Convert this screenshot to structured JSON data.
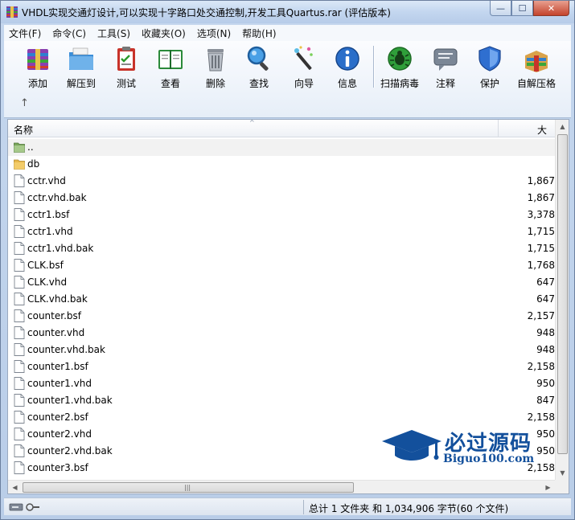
{
  "window": {
    "title": "VHDL实现交通灯设计,可以实现十字路口处交通控制,开发工具Quartus.rar (评估版本)",
    "controls": {
      "minimize": "—",
      "maximize": "☐",
      "close": "✕"
    }
  },
  "menu": [
    "文件(F)",
    "命令(C)",
    "工具(S)",
    "收藏夹(O)",
    "选项(N)",
    "帮助(H)"
  ],
  "toolbar": {
    "buttons": [
      {
        "id": "add",
        "label": "添加",
        "icon": "add-archive-icon"
      },
      {
        "id": "extract",
        "label": "解压到",
        "icon": "extract-folder-icon"
      },
      {
        "id": "test",
        "label": "测试",
        "icon": "test-clipboard-icon"
      },
      {
        "id": "view",
        "label": "查看",
        "icon": "view-book-icon"
      },
      {
        "id": "delete",
        "label": "删除",
        "icon": "trash-icon"
      },
      {
        "id": "find",
        "label": "查找",
        "icon": "magnifier-icon"
      },
      {
        "id": "wizard",
        "label": "向导",
        "icon": "magic-wand-icon"
      },
      {
        "id": "info",
        "label": "信息",
        "icon": "info-icon"
      },
      {
        "id": "scan",
        "label": "扫描病毒",
        "icon": "virus-scan-icon"
      },
      {
        "id": "comment",
        "label": "注释",
        "icon": "comment-icon"
      },
      {
        "id": "protect",
        "label": "保护",
        "icon": "shield-icon"
      },
      {
        "id": "sfx",
        "label": "自解压格",
        "icon": "sfx-box-icon"
      }
    ],
    "up_arrow": "↑"
  },
  "list": {
    "columns": {
      "name": "名称",
      "size": "大小"
    },
    "sort_indicator": "^",
    "rows": [
      {
        "name": "..",
        "size": "",
        "type": "parent"
      },
      {
        "name": "db",
        "size": "",
        "type": "folder"
      },
      {
        "name": "cctr.vhd",
        "size": "1,867",
        "type": "file"
      },
      {
        "name": "cctr.vhd.bak",
        "size": "1,867",
        "type": "file"
      },
      {
        "name": "cctr1.bsf",
        "size": "3,378",
        "type": "file"
      },
      {
        "name": "cctr1.vhd",
        "size": "1,715",
        "type": "file"
      },
      {
        "name": "cctr1.vhd.bak",
        "size": "1,715",
        "type": "file"
      },
      {
        "name": "CLK.bsf",
        "size": "1,768",
        "type": "file"
      },
      {
        "name": "CLK.vhd",
        "size": "647",
        "type": "file"
      },
      {
        "name": "CLK.vhd.bak",
        "size": "647",
        "type": "file"
      },
      {
        "name": "counter.bsf",
        "size": "2,157",
        "type": "file"
      },
      {
        "name": "counter.vhd",
        "size": "948",
        "type": "file"
      },
      {
        "name": "counter.vhd.bak",
        "size": "948",
        "type": "file"
      },
      {
        "name": "counter1.bsf",
        "size": "2,158",
        "type": "file"
      },
      {
        "name": "counter1.vhd",
        "size": "950",
        "type": "file"
      },
      {
        "name": "counter1.vhd.bak",
        "size": "847",
        "type": "file"
      },
      {
        "name": "counter2.bsf",
        "size": "2,158",
        "type": "file"
      },
      {
        "name": "counter2.vhd",
        "size": "950",
        "type": "file"
      },
      {
        "name": "counter2.vhd.bak",
        "size": "950",
        "type": "file"
      },
      {
        "name": "counter3.bsf",
        "size": "2,158",
        "type": "file"
      }
    ]
  },
  "scrollbars": {
    "up": "▲",
    "down": "▼",
    "left": "◀",
    "right": "▶",
    "grip": "|||"
  },
  "status": {
    "summary": "总计 1 文件夹 和 1,034,906 字节(60 个文件)"
  },
  "watermark": {
    "cn": "必过源码",
    "en": "Biguo100.com"
  },
  "colors": {
    "accent": "#13509c",
    "selection": "#f2f2f2",
    "folder": "#e8b84a"
  }
}
